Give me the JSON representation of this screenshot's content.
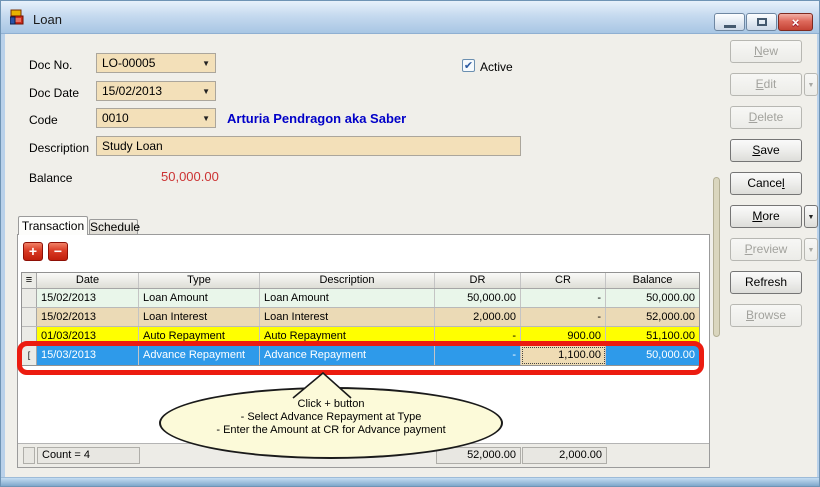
{
  "window": {
    "title": "Loan"
  },
  "form": {
    "doc_no_label": "Doc No.",
    "doc_no_value": "LO-00005",
    "doc_date_label": "Doc Date",
    "doc_date_value": "15/02/2013",
    "code_label": "Code",
    "code_value": "0010",
    "code_display_name": "Arturia Pendragon aka Saber",
    "active_label": "Active",
    "active_checked": true,
    "description_label": "Description",
    "description_value": "Study Loan",
    "balance_label": "Balance",
    "balance_value": "50,000.00"
  },
  "actions": [
    {
      "id": "new",
      "label": "New",
      "mnemonic": 0,
      "enabled": false,
      "dropdown": false
    },
    {
      "id": "edit",
      "label": "Edit",
      "mnemonic": 0,
      "enabled": false,
      "dropdown": true
    },
    {
      "id": "delete",
      "label": "Delete",
      "mnemonic": 0,
      "enabled": false,
      "dropdown": false
    },
    {
      "id": "save",
      "label": "Save",
      "mnemonic": 0,
      "enabled": true,
      "dropdown": false
    },
    {
      "id": "cancel",
      "label": "Cancel",
      "mnemonic": 5,
      "enabled": true,
      "dropdown": false
    },
    {
      "id": "more",
      "label": "More",
      "mnemonic": 0,
      "enabled": true,
      "dropdown": true
    },
    {
      "id": "preview",
      "label": "Preview",
      "mnemonic": 0,
      "enabled": false,
      "dropdown": true
    },
    {
      "id": "refresh",
      "label": "Refresh",
      "mnemonic": null,
      "enabled": true,
      "dropdown": false
    },
    {
      "id": "browse",
      "label": "Browse",
      "mnemonic": 0,
      "enabled": false,
      "dropdown": false
    }
  ],
  "tabs": [
    {
      "label": "Transaction",
      "active": true
    },
    {
      "label": "Schedule",
      "active": false
    }
  ],
  "grid": {
    "columns": [
      "Date",
      "Type",
      "Description",
      "DR",
      "CR",
      "Balance"
    ],
    "rows": [
      {
        "date": "15/02/2013",
        "type": "Loan Amount",
        "description": "Loan Amount",
        "dr": "50,000.00",
        "cr": "-",
        "balance": "50,000.00",
        "style": "green",
        "editing_cell": null
      },
      {
        "date": "15/02/2013",
        "type": "Loan Interest",
        "description": "Loan Interest",
        "dr": "2,000.00",
        "cr": "-",
        "balance": "52,000.00",
        "style": "tan",
        "editing_cell": null
      },
      {
        "date": "01/03/2013",
        "type": "Auto Repayment",
        "description": "Auto Repayment",
        "dr": "-",
        "cr": "900.00",
        "balance": "51,100.00",
        "style": "yellow",
        "editing_cell": null
      },
      {
        "date": "15/03/2013",
        "type": "Advance Repayment",
        "description": "Advance Repayment",
        "dr": "-",
        "cr": "1,100.00",
        "balance": "50,000.00",
        "style": "selected",
        "editing_cell": "cr"
      }
    ],
    "footer": {
      "count": "Count = 4",
      "dr_total": "52,000.00",
      "cr_total": "2,000.00"
    },
    "editing_marker": "["
  },
  "annotation": {
    "lines": [
      "Click + button",
      "- Select Advance Repayment at Type",
      "- Enter the Amount at CR for Advance payment"
    ]
  },
  "icons": {
    "combo_arrow": "▼",
    "dropdown_arrow": "▼",
    "grid_options": "≡",
    "splitter_arrow": ">",
    "check": "✔",
    "close": "×",
    "add": "+",
    "remove": "−"
  },
  "colors": {
    "row_green": "#E9F6EA",
    "row_tan": "#EBDAB6",
    "row_yellow": "#FFFF00",
    "row_selected_blue": "#2E9AEA",
    "field_beige": "#F3E0B9",
    "balance_red": "#CC3333",
    "name_blue": "#0000C8",
    "annotation_red": "#EC1C10",
    "callout_yellow": "#FCFAD9"
  }
}
